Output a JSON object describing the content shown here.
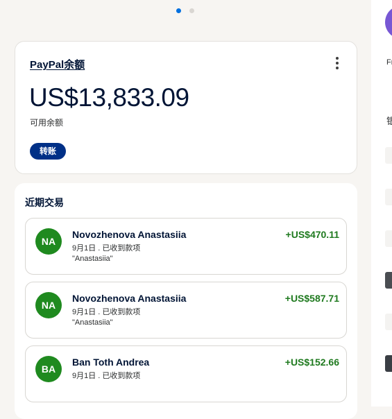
{
  "carousel": {
    "pages": 2,
    "active": 1
  },
  "balance": {
    "title": "PayPal余额",
    "amount": "US$13,833.09",
    "subtitle": "可用余额",
    "transfer_label": "转账",
    "more_icon": "more-vertical-icon"
  },
  "recent": {
    "title": "近期交易",
    "transactions": [
      {
        "initials": "NA",
        "name": "Novozhenova Anastasiia",
        "meta": "9月1日 . 已收到款项",
        "note": "\"Anastasiia\"",
        "amount": "+US$470.11"
      },
      {
        "initials": "NA",
        "name": "Novozhenova Anastasiia",
        "meta": "9月1日 . 已收到款项",
        "note": "\"Anastasiia\"",
        "amount": "+US$587.71"
      },
      {
        "initials": "BA",
        "name": "Ban Toth Andrea",
        "meta": "9月1日 . 已收到款项",
        "amount": "+US$152.66"
      }
    ]
  },
  "side": {
    "label_fr": "Fr",
    "label_bank": "银"
  },
  "colors": {
    "background": "#f7f5f2",
    "primary_button": "#003087",
    "avatar_green": "#1f8a1f",
    "amount_green": "#1f7a1f",
    "active_dot": "#0070e0",
    "side_avatar": "#7757d4"
  }
}
